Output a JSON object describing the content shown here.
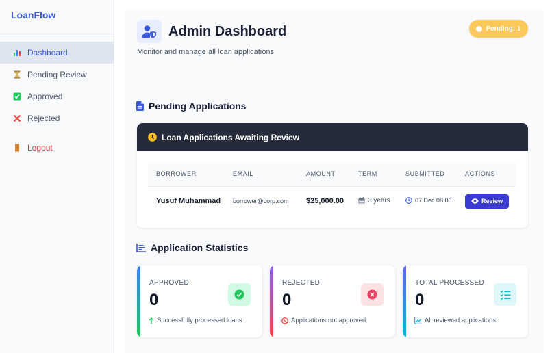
{
  "app": {
    "brand": "LoanFlow"
  },
  "sidebar": {
    "items": [
      {
        "label": "Dashboard",
        "icon": "bar-chart-icon"
      },
      {
        "label": "Pending Review",
        "icon": "hourglass-icon"
      },
      {
        "label": "Approved",
        "icon": "check-box-icon"
      },
      {
        "label": "Rejected",
        "icon": "x-icon"
      },
      {
        "label": "Logout",
        "icon": "door-icon"
      }
    ]
  },
  "header": {
    "title": "Admin Dashboard",
    "subtitle": "Monitor and manage all loan applications",
    "pending_badge": "Pending: 1"
  },
  "pending_section": {
    "title": "Pending Applications",
    "card_title": "Loan Applications Awaiting Review",
    "columns": [
      "BORROWER",
      "EMAIL",
      "AMOUNT",
      "TERM",
      "SUBMITTED",
      "ACTIONS"
    ],
    "rows": [
      {
        "borrower": "Yusuf Muhammad",
        "email": "borrower@corp.com",
        "amount": "$25,000.00",
        "term": "3 years",
        "submitted": "07 Dec 08:06",
        "action": "Review"
      }
    ]
  },
  "stats_section": {
    "title": "Application Statistics",
    "cards": [
      {
        "label": "APPROVED",
        "value": "0",
        "footer": "Successfully processed loans",
        "accent": "#22c55e"
      },
      {
        "label": "REJECTED",
        "value": "0",
        "footer": "Applications not approved",
        "accent": "#ef4444"
      },
      {
        "label": "TOTAL PROCESSED",
        "value": "0",
        "footer": "All reviewed applications",
        "accent": "#06b6d4"
      }
    ]
  },
  "colors": {
    "brand": "#3b5bdb",
    "pending": "#fcc85a",
    "card_header": "#252b3a",
    "review_button": "#3b3bd1"
  }
}
